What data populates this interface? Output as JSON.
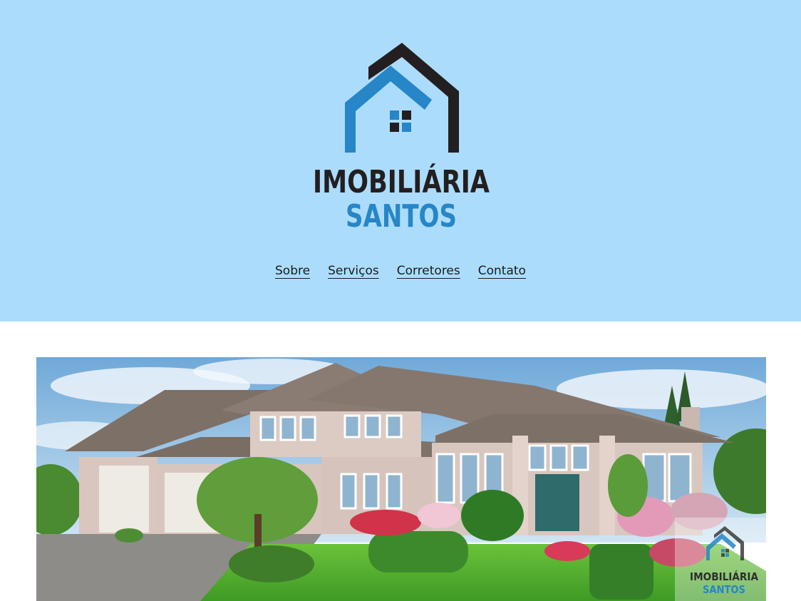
{
  "brand": {
    "line1": "IMOBILIÁRIA",
    "line2": "SANTOS",
    "colors": {
      "dark": "#231f20",
      "blue": "#2686c8"
    }
  },
  "nav": {
    "items": [
      {
        "label": "Sobre"
      },
      {
        "label": "Serviços"
      },
      {
        "label": "Corretores"
      },
      {
        "label": "Contato"
      }
    ]
  },
  "hero": {
    "watermark_line1": "IMOBILIÁRIA",
    "watermark_line2": "SANTOS"
  },
  "colors": {
    "header_bg": "#acdcfc",
    "page_bg": "#ffffff"
  }
}
